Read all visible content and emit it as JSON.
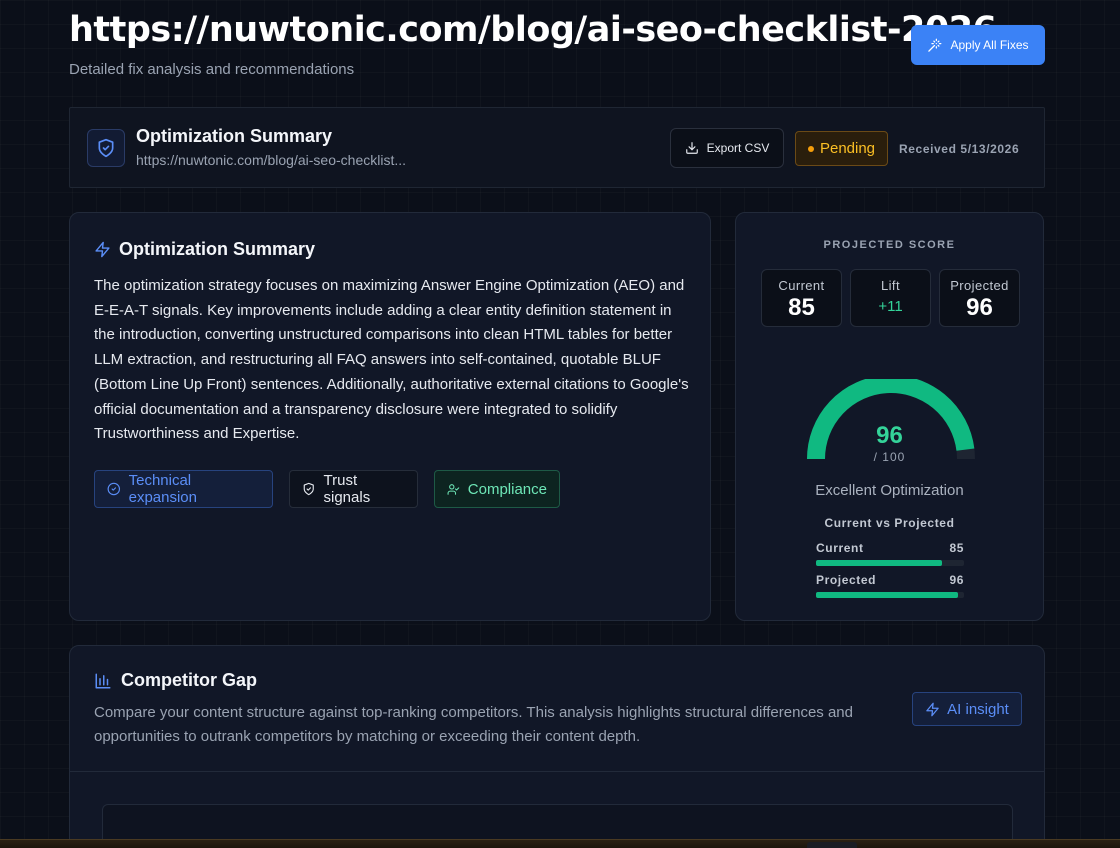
{
  "page": {
    "title": "https://nuwtonic.com/blog/ai-seo-checklist-2026",
    "subtitle": "Detailed fix analysis and recommendations",
    "apply_label": "Apply All Fixes"
  },
  "summary_header": {
    "title": "Optimization Summary",
    "url": "https://nuwtonic.com/blog/ai-seo-checklist...",
    "export_label": "Export CSV",
    "status": "Pending",
    "received": "Received 5/13/2026"
  },
  "summary_card": {
    "title": "Optimization Summary",
    "body": "The optimization strategy focuses on maximizing Answer Engine Optimization (AEO) and E-E-A-T signals. Key improvements include adding a clear entity definition statement in the introduction, converting unstructured comparisons into clean HTML tables for better LLM extraction, and restructuring all FAQ answers into self-contained, quotable BLUF (Bottom Line Up Front) sentences. Additionally, authoritative external citations to Google's official documentation and a transparency disclosure were integrated to solidify Trustworthiness and Expertise.",
    "chips": [
      "Technical expansion",
      "Trust signals",
      "Compliance"
    ]
  },
  "score": {
    "label": "PROJECTED SCORE",
    "current_label": "Current",
    "current": "85",
    "lift_label": "Lift",
    "lift": "+11",
    "projected_label": "Projected",
    "projected": "96",
    "gauge_value": "96",
    "gauge_max": "/ 100",
    "gauge_fraction": 0.96,
    "rating": "Excellent Optimization",
    "compare_title": "Current vs Projected",
    "bars": [
      {
        "label": "Current",
        "value": "85",
        "fraction": 0.85
      },
      {
        "label": "Projected",
        "value": "96",
        "fraction": 0.96
      }
    ]
  },
  "competitor": {
    "title": "Competitor Gap",
    "description": "Compare your content structure against top-ranking competitors. This analysis highlights structural differences and opportunities to outrank competitors by matching or exceeding their content depth.",
    "ai_label": "AI insight"
  },
  "colors": {
    "accent": "#3b82f6",
    "success": "#10b981",
    "warning": "#f59e0b",
    "background": "#0b0f19"
  }
}
